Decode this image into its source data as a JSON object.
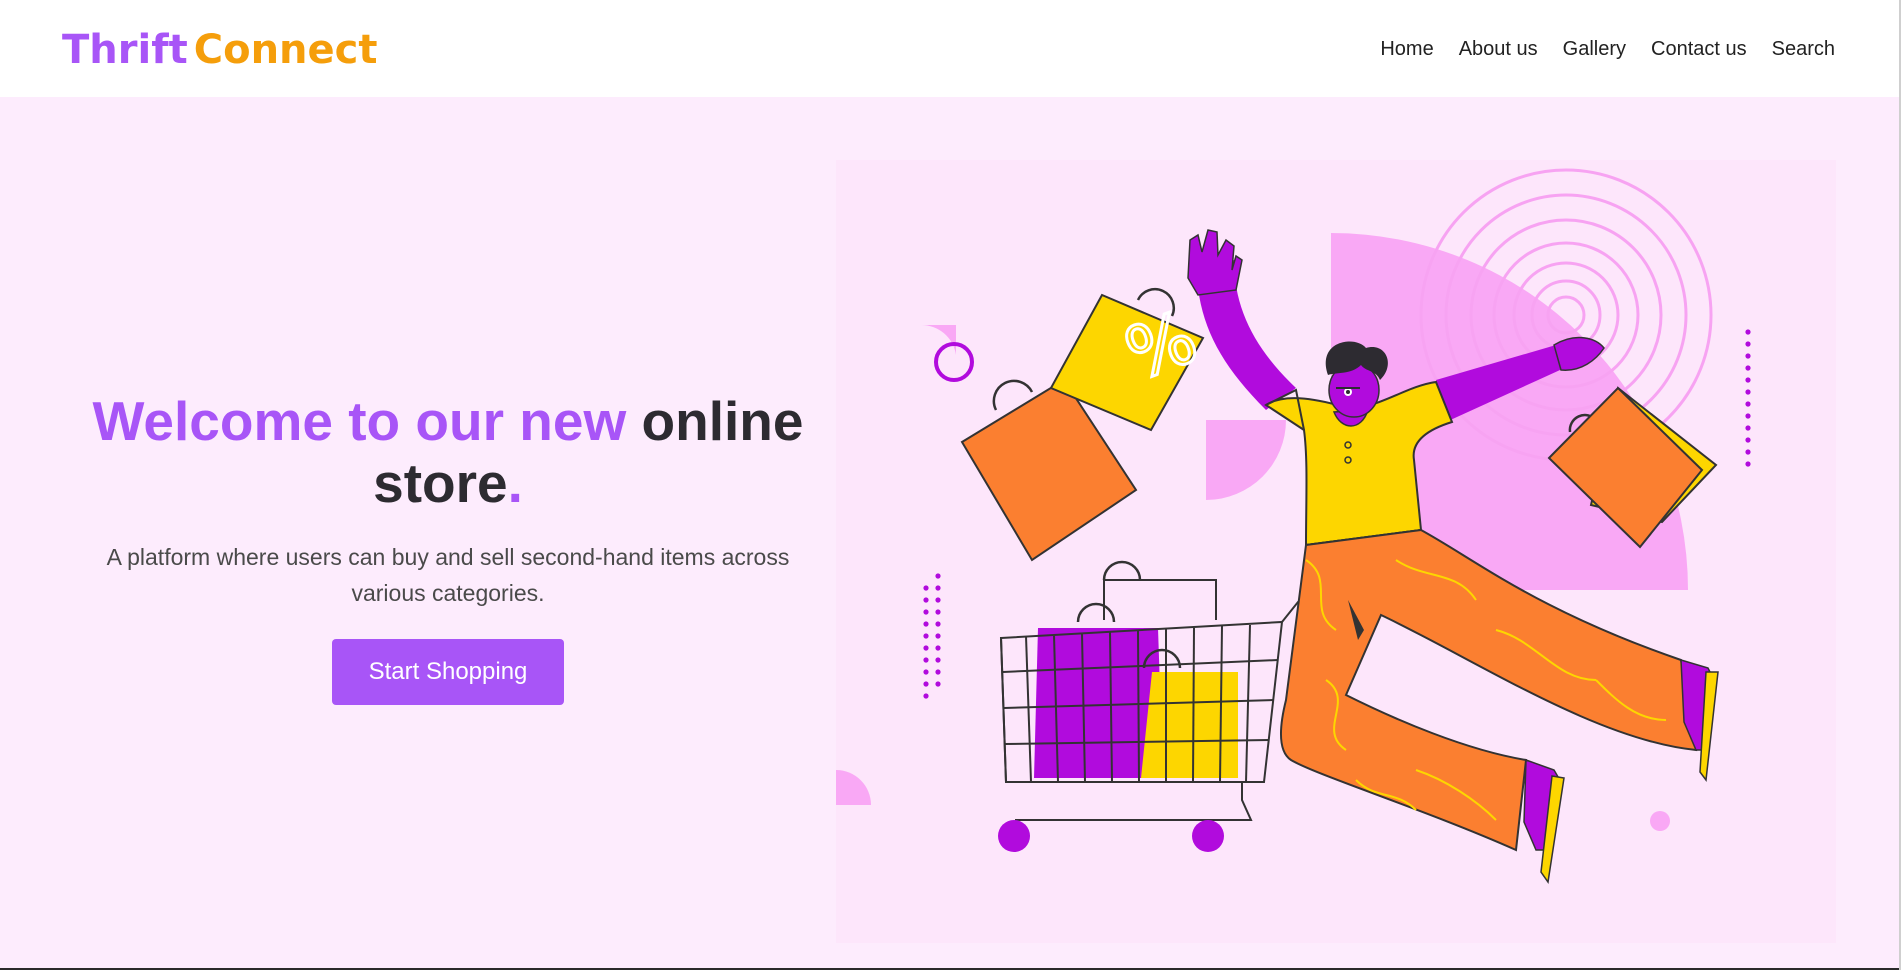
{
  "brand": {
    "logo_part_1": "Thrift",
    "logo_part_2": "Connect",
    "colors": {
      "purple": "#a855f7",
      "orange": "#f59e0b"
    }
  },
  "nav": {
    "items": [
      {
        "label": "Home"
      },
      {
        "label": "About us"
      },
      {
        "label": "Gallery"
      },
      {
        "label": "Contact us"
      },
      {
        "label": "Search"
      }
    ]
  },
  "hero": {
    "headline": {
      "purple_part": "Welcome to our new",
      "dark_part_1": "online",
      "dark_part_2": "store",
      "accent_dot": "."
    },
    "tagline": "A platform where users can buy and sell second-hand items across various categories.",
    "cta_label": "Start Shopping",
    "background_color": "#fdecfd",
    "illustration": {
      "percent_glyph": "%"
    }
  }
}
